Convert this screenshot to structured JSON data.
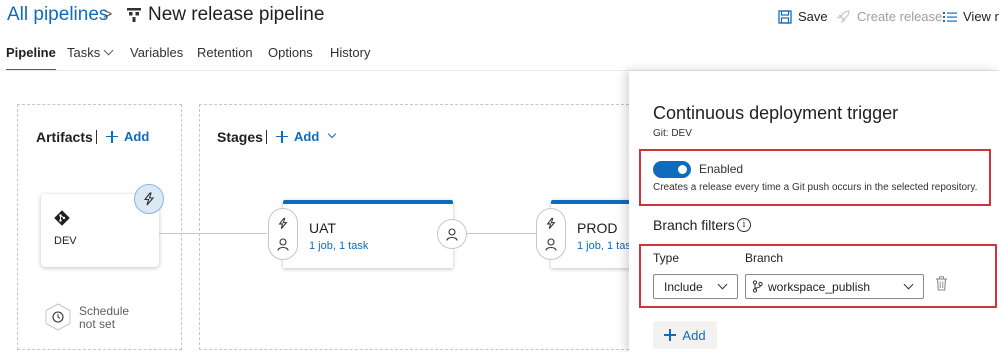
{
  "header": {
    "breadcrumb_root": "All pipelines",
    "breadcrumb_separator": ">",
    "pipeline_title": "New release pipeline",
    "commands": {
      "save": "Save",
      "create_release": "Create release",
      "view_releases": "View re"
    }
  },
  "tabs": [
    {
      "label": "Pipeline",
      "active": true
    },
    {
      "label": "Tasks",
      "has_dropdown": true
    },
    {
      "label": "Variables"
    },
    {
      "label": "Retention"
    },
    {
      "label": "Options"
    },
    {
      "label": "History"
    }
  ],
  "artifacts": {
    "title": "Artifacts",
    "add_label": "Add",
    "items": [
      {
        "name": "DEV",
        "icon": "git-icon"
      }
    ],
    "schedule": {
      "line1": "Schedule",
      "line2": "not set"
    }
  },
  "stages": {
    "title": "Stages",
    "add_label": "Add",
    "items": [
      {
        "name": "UAT",
        "summary": "1 job, 1 task"
      },
      {
        "name": "PROD",
        "summary": "1 job, 1 task"
      }
    ]
  },
  "panel": {
    "title": "Continuous deployment trigger",
    "subtitle": "Git: DEV",
    "toggle": {
      "label": "Enabled",
      "on": true,
      "description": "Creates a release every time a Git push occurs in the selected repository."
    },
    "branch_filters": {
      "title": "Branch filters",
      "type_header": "Type",
      "branch_header": "Branch",
      "rows": [
        {
          "type": "Include",
          "branch": "workspace_publish"
        }
      ],
      "add_label": "Add"
    }
  },
  "colors": {
    "accent": "#0f6cbd",
    "highlight": "#d13438",
    "disabled_text": "#a19f9d"
  }
}
